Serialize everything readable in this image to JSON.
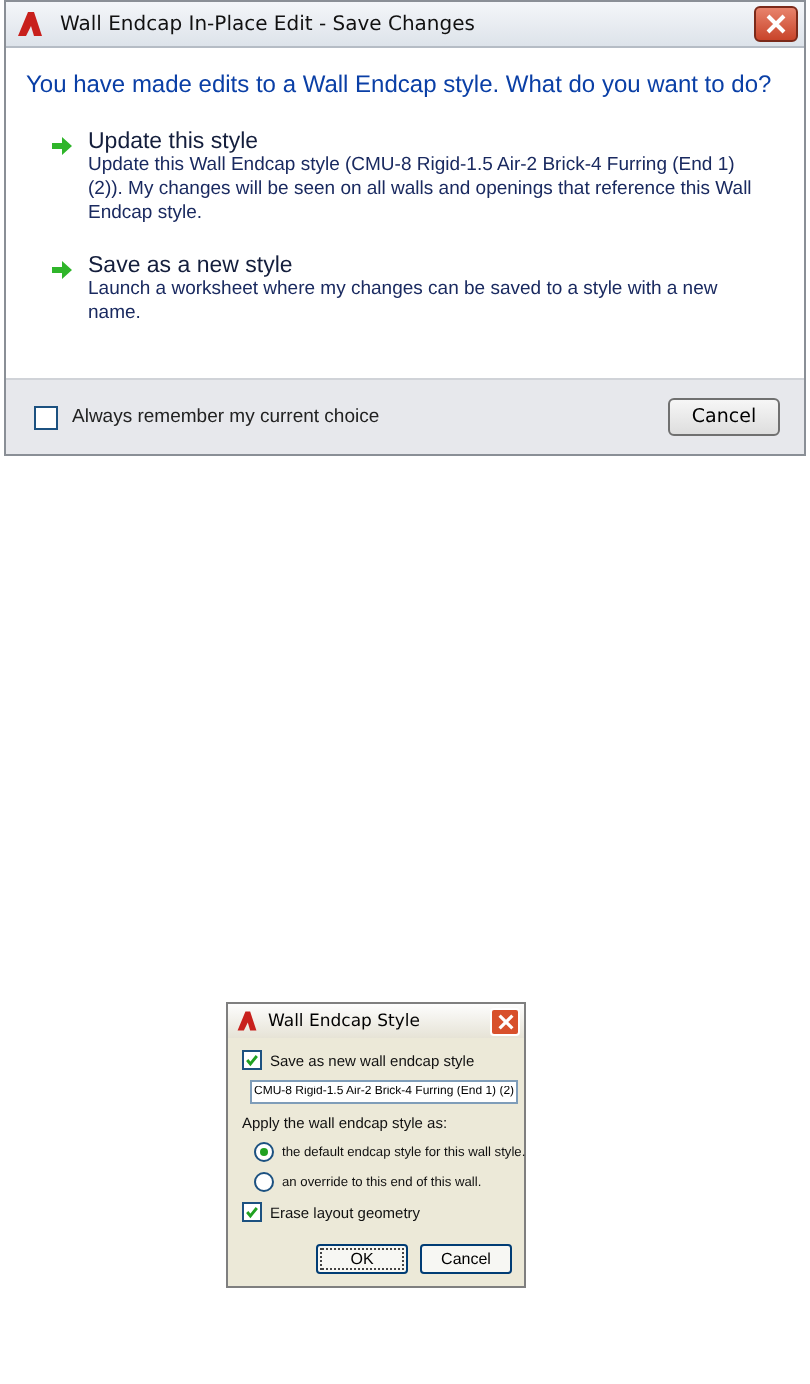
{
  "dialog": {
    "title": "Wall Endcap In-Place Edit - Save Changes",
    "heading": "You have made edits to a Wall Endcap style. What do you want to do?",
    "options": [
      {
        "title": "Update this style",
        "description": "Update this Wall Endcap style (CMU-8 Rigid-1.5 Air-2 Brick-4 Furring (End 1) (2)). My changes will be seen on all walls and openings that reference this Wall Endcap style."
      },
      {
        "title": "Save as a new style",
        "description": "Launch a worksheet where my changes can be saved to a style with a new name."
      }
    ],
    "remember": {
      "label": "Always remember my current choice",
      "checked": false
    },
    "buttons": [
      "Cancel"
    ]
  },
  "style_dialog": {
    "title": "Wall Endcap Style",
    "save_as_new": {
      "label": "Save as new wall endcap style",
      "checked": true
    },
    "name": {
      "value": "CMU-8 Rigid-1.5 Air-2 Brick-4 Furring (End 1) (2)"
    },
    "apply_label": "Apply the wall endcap style as:",
    "radios": [
      {
        "label": "the default endcap style for this wall style.",
        "selected": true
      },
      {
        "label": "an override to this end of this wall.",
        "selected": false
      }
    ],
    "erase": {
      "label": "Erase layout geometry",
      "checked": true
    },
    "buttons": [
      "OK",
      "Cancel"
    ]
  }
}
